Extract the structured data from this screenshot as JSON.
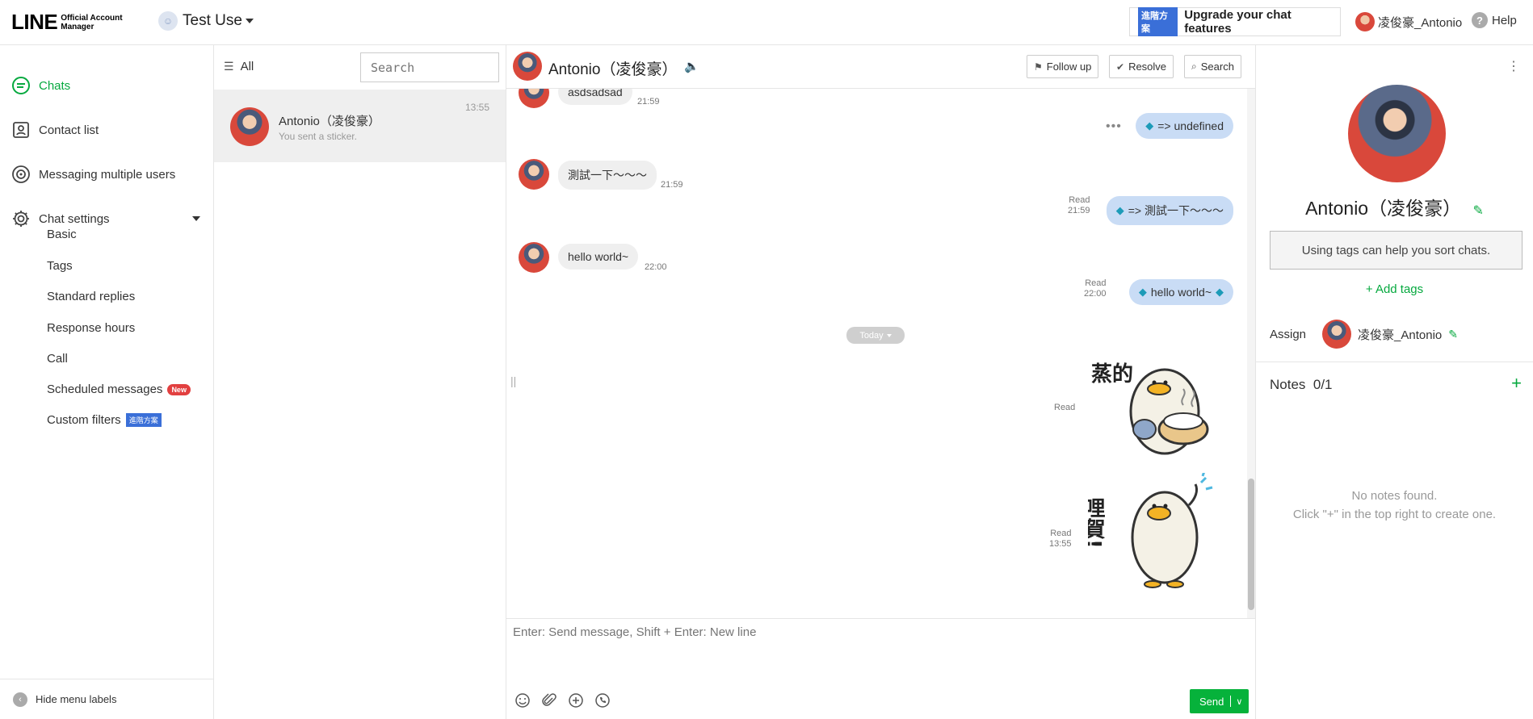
{
  "topbar": {
    "logo_main": "LINE",
    "logo_sub_line1": "Official Account",
    "logo_sub_line2": "Manager",
    "account_name": "Test Use",
    "upgrade_badge": "進階方案",
    "upgrade_label": "Upgrade your chat features",
    "user_name": "凌俊豪_Antonio",
    "help_label": "Help"
  },
  "sidebar": {
    "items": [
      {
        "label": "Chats",
        "icon": "chat-bubble-icon"
      },
      {
        "label": "Contact list",
        "icon": "contact-icon"
      },
      {
        "label": "Messaging multiple users",
        "icon": "broadcast-icon"
      },
      {
        "label": "Chat settings",
        "icon": "gear-icon"
      }
    ],
    "sub_items": [
      "Basic",
      "Tags",
      "Standard replies",
      "Response hours",
      "Call",
      "Scheduled messages",
      "Custom filters"
    ],
    "new_badge": "New",
    "adv_badge": "進階方案",
    "hide_labels": "Hide menu labels"
  },
  "chatlist": {
    "filter_label": "All",
    "search_placeholder": "Search",
    "chats": [
      {
        "name": "Antonio（凌俊豪）",
        "last_message": "You sent a sticker.",
        "time": "13:55"
      }
    ]
  },
  "chat": {
    "header_name": "Antonio（凌俊豪）",
    "buttons": {
      "follow_up": "Follow up",
      "resolve": "Resolve",
      "search": "Search"
    },
    "messages": [
      {
        "dir": "in",
        "text": "asdsadsad",
        "time": "21:59"
      },
      {
        "dir": "out",
        "text": "=> undefined"
      },
      {
        "dir": "in",
        "text": "測試一下～～～",
        "time": "21:59"
      },
      {
        "dir": "out",
        "text": "=> 測試一下～～～",
        "read": "Read",
        "time": "21:59"
      },
      {
        "dir": "in",
        "text": "hello world~",
        "time": "22:00"
      },
      {
        "dir": "out",
        "text": "hello world~",
        "read": "Read",
        "time": "22:00"
      }
    ],
    "date_divider": "Today",
    "sticker1": {
      "read": "Read",
      "caption": "蒸的"
    },
    "sticker2": {
      "read": "Read",
      "time": "13:55",
      "caption": "哩賀!"
    },
    "composer_placeholder": "Enter: Send message, Shift + Enter: New line",
    "send_label": "Send"
  },
  "profile": {
    "name": "Antonio（凌俊豪）",
    "tags_hint": "Using tags can help you sort chats.",
    "add_tags": "Add tags",
    "assign_label": "Assign",
    "assignee": "凌俊豪_Antonio",
    "notes_label": "Notes",
    "notes_count": "0/1",
    "notes_empty_1": "No notes found.",
    "notes_empty_2": "Click \"+\" in the top right to create one."
  },
  "colors": {
    "accent_green": "#06a93f",
    "bubble_out": "#c9dcf5",
    "bubble_in": "#efefef",
    "brand_blue": "#3a6fd8"
  }
}
